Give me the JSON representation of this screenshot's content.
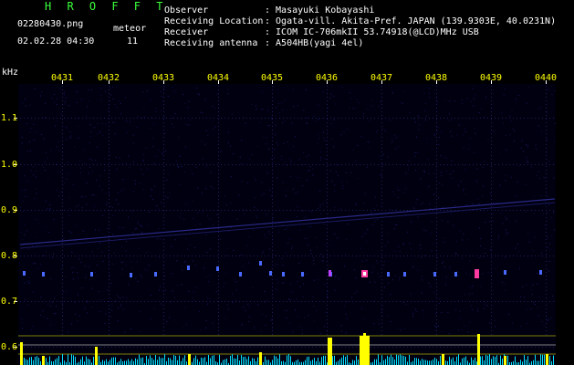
{
  "header": {
    "title": "H R O F F T",
    "filename": "02280430.png",
    "meteor_label": "meteor",
    "datetime": "02.02.28 04:30",
    "meteor_count": "11"
  },
  "info": [
    {
      "label": "Observer",
      "value": ": Masayuki Kobayashi"
    },
    {
      "label": "Receiving Location",
      "value": ": Ogata-vill. Akita-Pref. JAPAN (139.9303E, 40.0231N)"
    },
    {
      "label": "Receiver",
      "value": ": ICOM IC-706mkII 53.74918(@LCD)MHz USB"
    },
    {
      "label": "Receiving antenna",
      "value": ": A504HB(yagi 4el)"
    }
  ],
  "spectrogram": {
    "y_unit": "kHz",
    "y_ticks": [
      "1.1",
      "1.0",
      "0.9",
      "0.8",
      "0.7",
      "0.6"
    ],
    "x_ticks": [
      "0431",
      "0432",
      "0433",
      "0434",
      "0435",
      "0436",
      "0437",
      "0438",
      "0439",
      "0440"
    ],
    "colors": {
      "background": "#000000",
      "grid": "#1e1e5a",
      "labels": "#ffff00",
      "signal": "#ffff00",
      "noise": "#00e0ff"
    }
  }
}
